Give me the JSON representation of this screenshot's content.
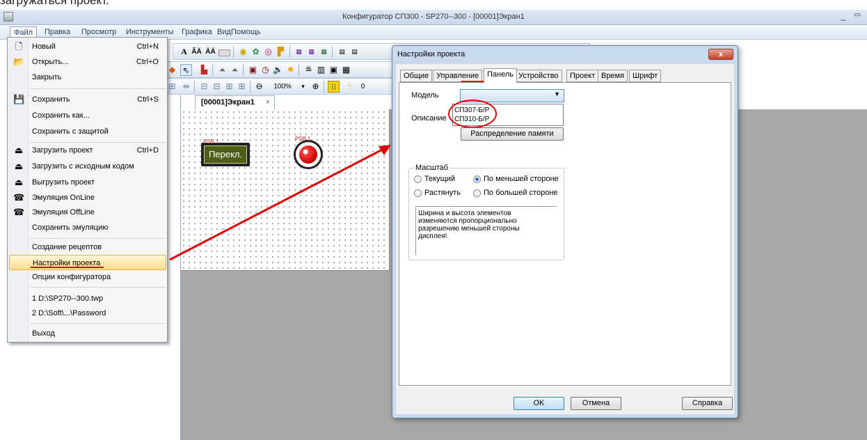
{
  "caption": "загружаться проект.",
  "window": {
    "title": "Конфигуратор СП300 - SP270--300 - [00001]Экран1",
    "minimize": "_",
    "restore": "▭"
  },
  "menubar": [
    "Файл",
    "Правка",
    "Просмотр",
    "Инструменты",
    "Графика",
    "Вид",
    "Помощь"
  ],
  "toolbar": {
    "text_icons": [
      "A",
      "ÃÄ",
      "ÄÄ"
    ],
    "zoom": "100%",
    "value": "0"
  },
  "screen_tab": {
    "label": "[00001]Экран1",
    "close": "×"
  },
  "canvas": {
    "switch_label": "Перекл.",
    "switch_tag": "PSB.1",
    "lamp_tag": "PSB.1"
  },
  "file_menu": {
    "items": [
      {
        "label": "Новый",
        "shortcut": "Ctrl+N",
        "icon": "new-file-icon",
        "glyph": "🗋"
      },
      {
        "label": "Открыть...",
        "shortcut": "Ctrl+O",
        "icon": "open-folder-icon",
        "glyph": "📂"
      },
      {
        "label": "Закрыть",
        "shortcut": "",
        "icon": "",
        "glyph": ""
      },
      {
        "label": "Сохранить",
        "shortcut": "Ctrl+S",
        "icon": "save-icon",
        "glyph": "💾"
      },
      {
        "label": "Сохранить как...",
        "shortcut": "",
        "icon": "",
        "glyph": ""
      },
      {
        "label": "Сохранить с защитой",
        "shortcut": "",
        "icon": "",
        "glyph": ""
      },
      {
        "label": "Загрузить проект",
        "shortcut": "Ctrl+D",
        "icon": "download-project-icon",
        "glyph": "⏏"
      },
      {
        "label": "Загрузить с исходным кодом",
        "shortcut": "",
        "icon": "download-source-icon",
        "glyph": "⏏"
      },
      {
        "label": "Выгрузить проект",
        "shortcut": "",
        "icon": "upload-project-icon",
        "glyph": "⏏"
      },
      {
        "label": "Эмуляция OnLine",
        "shortcut": "",
        "icon": "emulation-online-icon",
        "glyph": "☎"
      },
      {
        "label": "Эмуляция OffLine",
        "shortcut": "",
        "icon": "emulation-offline-icon",
        "glyph": "☎"
      },
      {
        "label": "Сохранить эмуляцию",
        "shortcut": "",
        "icon": "",
        "glyph": ""
      },
      {
        "label": "Создание рецептов",
        "shortcut": "",
        "icon": "",
        "glyph": ""
      },
      {
        "label": "Настройки проекта",
        "shortcut": "",
        "icon": "",
        "glyph": ""
      },
      {
        "label": "Опции конфигуратора",
        "shortcut": "",
        "icon": "",
        "glyph": ""
      },
      {
        "label": "1 D:\\SP270--300.twp",
        "shortcut": "",
        "icon": "",
        "glyph": ""
      },
      {
        "label": "2 D:\\Soft\\...\\Password",
        "shortcut": "",
        "icon": "",
        "glyph": ""
      },
      {
        "label": "Выход",
        "shortcut": "",
        "icon": "",
        "glyph": ""
      }
    ]
  },
  "dialog": {
    "title": "Настройки проекта",
    "close": "x",
    "tabs": [
      "Общие",
      "Управление",
      "Панель",
      "Устройство",
      "Проект",
      "Время",
      "Шрифт"
    ],
    "active_tab": "Панель",
    "model_label": "Модель",
    "model_options": [
      "СП307-Б/Р",
      "СП310-Б/Р"
    ],
    "description_label": "Описание",
    "memory_button": "Распределение памяти",
    "scale": {
      "legend": "Масштаб",
      "options": [
        "Текущий",
        "По меньшей стороне",
        "Растянуть",
        "По большей стороне"
      ],
      "selected": "По меньшей стороне",
      "note": "Ширина и высота элементов\nизменяются пропорционально\nразрешению меньшей стороны\nдисплея!"
    },
    "buttons": {
      "ok": "OK",
      "cancel": "Отмена",
      "help": "Справка"
    }
  },
  "colors": {
    "annotation": "#e00000",
    "workspace": "#a8a8a8"
  }
}
